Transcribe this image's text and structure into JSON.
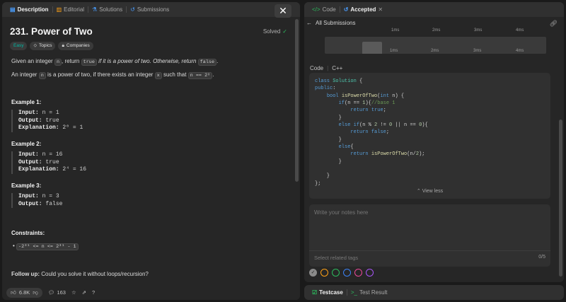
{
  "left_tabs": [
    {
      "label": "Description",
      "active": true
    },
    {
      "label": "Editorial"
    },
    {
      "label": "Solutions"
    },
    {
      "label": "Submissions"
    }
  ],
  "close_label": "✕",
  "problem": {
    "title": "231. Power of Two",
    "status": "Solved",
    "difficulty": "Easy",
    "chips": [
      "Topics",
      "Companies"
    ],
    "para1": {
      "a": "Given an integer ",
      "n": "n",
      "b": ", return ",
      "true": "true",
      "c": " if it is a power of two. Otherwise, return ",
      "false": "false",
      "d": "."
    },
    "para2": {
      "a": "An integer ",
      "n": "n",
      "b": " is a power of two, if there exists an integer ",
      "x": "x",
      "c": " such that ",
      "expr": "n == 2ˣ",
      "d": "."
    },
    "examples": [
      {
        "heading": "Example 1:",
        "input": "n = 1",
        "output": "true",
        "explanation": "2⁰ = 1"
      },
      {
        "heading": "Example 2:",
        "input": "n = 16",
        "output": "true",
        "explanation": "2⁴ = 16"
      },
      {
        "heading": "Example 3:",
        "input": "n = 3",
        "output": "false"
      }
    ],
    "labels": {
      "input": "Input:",
      "output": "Output:",
      "explanation": "Explanation:"
    },
    "constraints_heading": "Constraints:",
    "constraint": "-2³¹ <= n <= 2³¹ - 1",
    "followup_label": "Follow up:",
    "followup_text": " Could you solve it without loops/recursion?"
  },
  "footer": {
    "likes": "6.8K",
    "comments": "163"
  },
  "right_tabs": [
    {
      "label": "Code"
    },
    {
      "label": "Accepted",
      "active": true
    }
  ],
  "all_submissions": "All Submissions",
  "runtime_chart": {
    "top_labels": [
      "1ms",
      "2ms",
      "3ms",
      "4ms"
    ],
    "bottom_labels": [
      "1ms",
      "2ms",
      "3ms",
      "4ms"
    ]
  },
  "code_section": {
    "label": "Code",
    "lang": "C++",
    "view_less": "View less"
  },
  "notes": {
    "placeholder": "Write your notes here",
    "tags_placeholder": "Select related tags",
    "count": "0/5"
  },
  "bottom_tabs": [
    {
      "label": "Testcase",
      "active": true
    },
    {
      "label": "Test Result"
    }
  ],
  "colors": {
    "accent_green": "#2cbb5d",
    "easy": "#00b8a3",
    "note_colors": [
      "#8a8a8a",
      "#ffa116",
      "#2cbb5d",
      "#3b82f6",
      "#ec4899",
      "#a855f7"
    ]
  }
}
